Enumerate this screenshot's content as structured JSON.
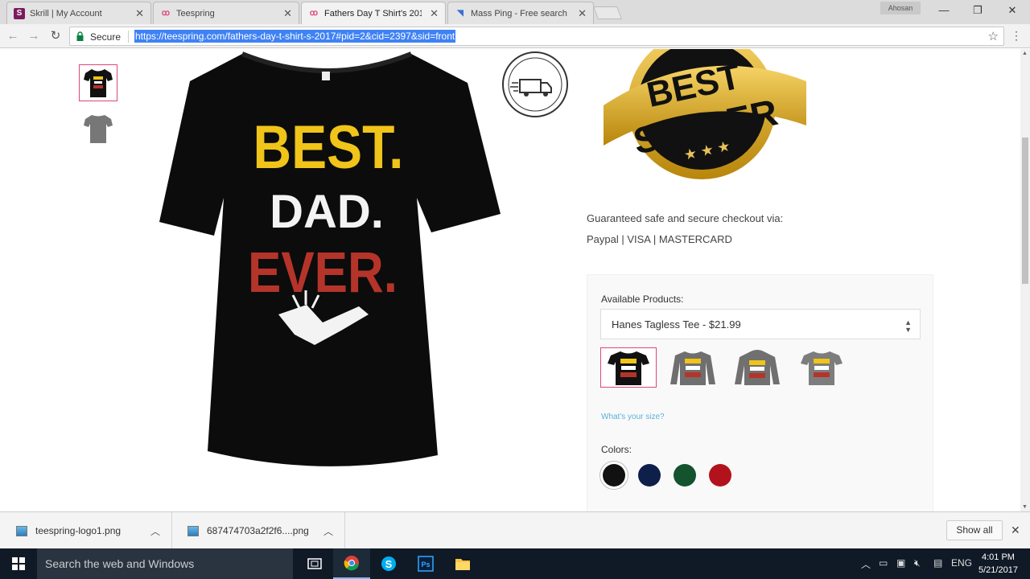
{
  "browser": {
    "tabs": [
      {
        "title": "Skrill | My Account",
        "favicon": "S",
        "active": false
      },
      {
        "title": "Teespring",
        "favicon": "teespring-logo",
        "active": false
      },
      {
        "title": "Fathers Day T Shirt's 201",
        "favicon": "teespring-logo",
        "active": true
      },
      {
        "title": "Mass Ping - Free search",
        "favicon": "ping-logo",
        "active": false
      }
    ],
    "profile_name": "Ahosan",
    "secure_label": "Secure",
    "url": "https://teespring.com/fathers-day-t-shirt-s-2017#pid=2&cid=2397&sid=front"
  },
  "product": {
    "shirt_print": {
      "line1": "BEST.",
      "line2": "DAD.",
      "line3": "EVER."
    },
    "badge_rush": "RUSH SHIPPING AVAILABLE",
    "badge_seller": {
      "line1": "BEST",
      "line2": "SELLER"
    },
    "guarantee_text": "Guaranteed safe and secure checkout via:",
    "payment_methods": "Paypal | VISA | MASTERCARD",
    "available_label": "Available Products:",
    "selected_product": "Hanes Tagless Tee - $21.99",
    "size_link": "What's your size?",
    "colors_label": "Colors:",
    "colors": [
      "#111111",
      "#0e1f4a",
      "#14532d",
      "#b3121c"
    ],
    "selected_color_index": 0,
    "product_variants": [
      "black-tee",
      "grey-longsleeve",
      "grey-hoodie",
      "grey-tee"
    ]
  },
  "downloads": {
    "items": [
      {
        "name": "teespring-logo1.png"
      },
      {
        "name": "687474703a2f2f6....png"
      }
    ],
    "show_all": "Show all"
  },
  "taskbar": {
    "search_placeholder": "Search the web and Windows",
    "language": "ENG",
    "time": "4:01 PM",
    "date": "5/21/2017"
  }
}
